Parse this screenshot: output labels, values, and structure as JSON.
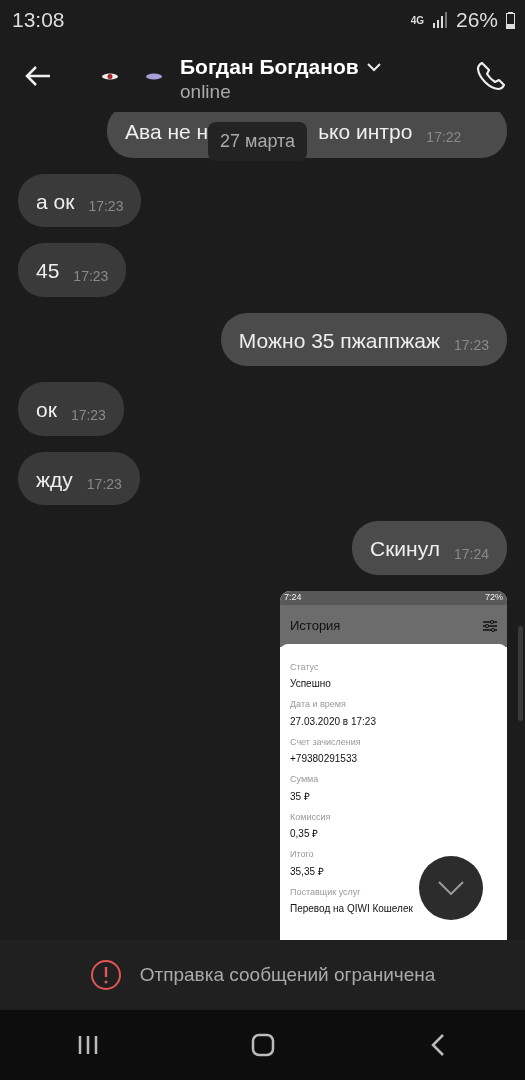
{
  "status_bar": {
    "time": "13:08",
    "network": "4G",
    "battery": "26%"
  },
  "header": {
    "name": "Богдан Богданов",
    "presence": "online"
  },
  "date_chip": "27 марта",
  "messages": [
    {
      "kind": "outgoing",
      "text_parts": [
        "Ава не н",
        "ько интро"
      ],
      "time": "17:22"
    },
    {
      "kind": "incoming",
      "text": "а ок",
      "time": "17:23"
    },
    {
      "kind": "incoming",
      "text": "45",
      "time": "17:23"
    },
    {
      "kind": "outgoing",
      "text": "Можно 35 пжаппжаж",
      "time": "17:23"
    },
    {
      "kind": "incoming",
      "text": "ок",
      "time": "17:23"
    },
    {
      "kind": "incoming",
      "text": "жду",
      "time": "17:23"
    },
    {
      "kind": "outgoing",
      "text": "Скинул",
      "time": "17:24"
    },
    {
      "kind": "image",
      "screenshot": {
        "time": "7:24",
        "battery": "72%",
        "title": "История",
        "fields": [
          {
            "label": "Статус",
            "value": "Успешно"
          },
          {
            "label": "Дата и время",
            "value": "27.03.2020 в 17:23"
          },
          {
            "label": "Счет зачисления",
            "value": "+79380291533"
          },
          {
            "label": "Сумма",
            "value": "35 ₽"
          },
          {
            "label": "Комиссия",
            "value": "0,35 ₽"
          },
          {
            "label": "Итого",
            "value": "35,35 ₽"
          },
          {
            "label": "Поставщик услуг",
            "value": "Перевод на QIWI Кошелек"
          }
        ]
      }
    }
  ],
  "restriction_notice": "Отправка сообщений ограничена"
}
